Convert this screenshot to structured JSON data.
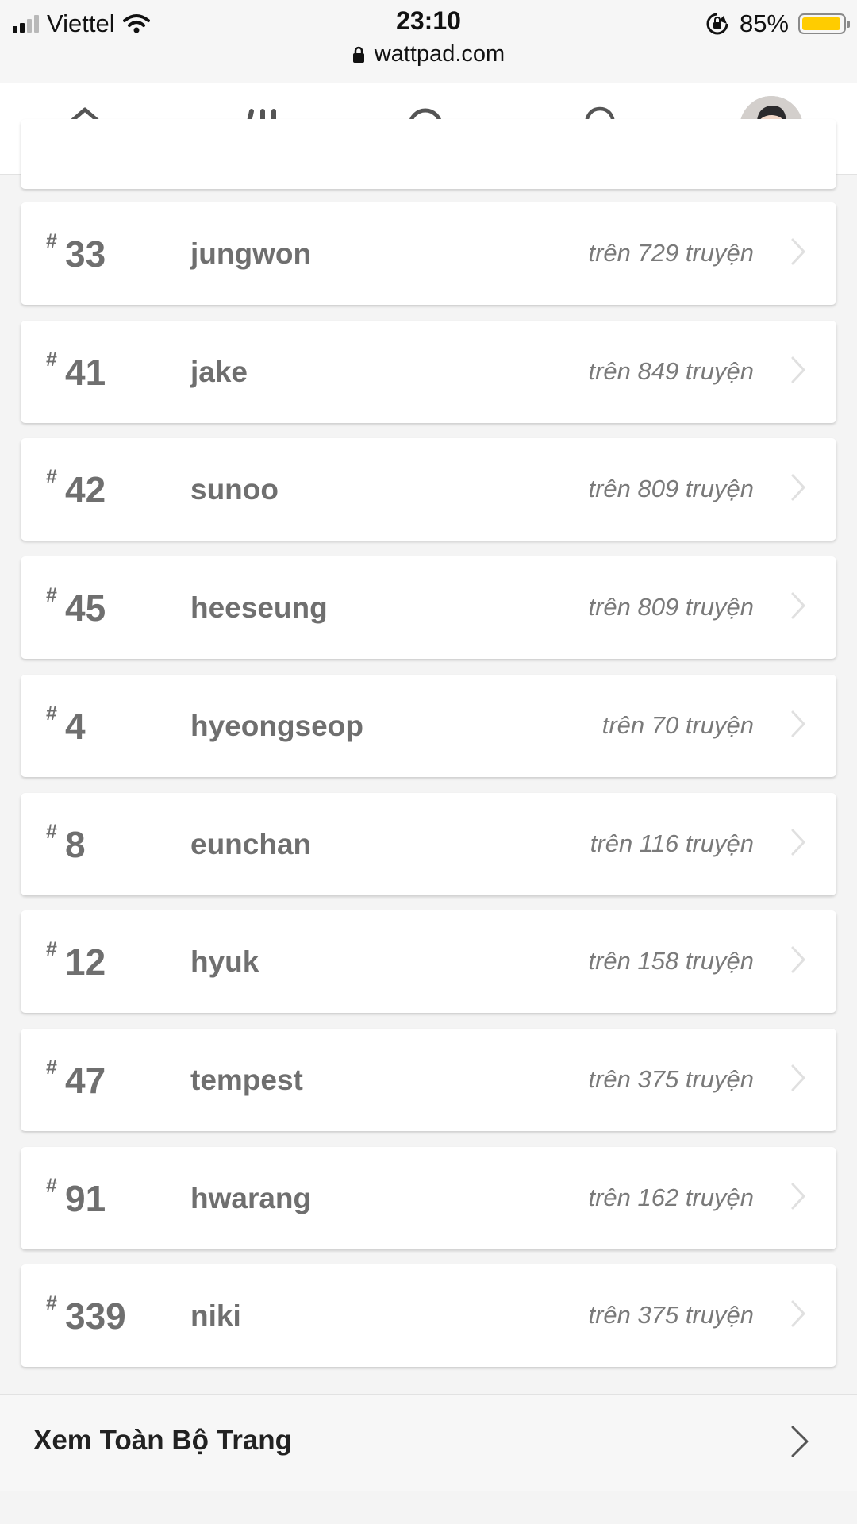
{
  "status_bar": {
    "carrier": "Viettel",
    "time": "23:10",
    "battery_percent": "85%",
    "battery_level": 0.85,
    "url": "wattpad.com"
  },
  "nav": {
    "icons": [
      "home-icon",
      "library-icon",
      "search-icon",
      "bell-icon",
      "avatar"
    ]
  },
  "tags": [
    {
      "hash": "#",
      "rank": "33",
      "name": "jungwon",
      "count": "trên 729 truyện"
    },
    {
      "hash": "#",
      "rank": "41",
      "name": "jake",
      "count": "trên 849 truyện"
    },
    {
      "hash": "#",
      "rank": "42",
      "name": "sunoo",
      "count": "trên 809 truyện"
    },
    {
      "hash": "#",
      "rank": "45",
      "name": "heeseung",
      "count": "trên 809 truyện"
    },
    {
      "hash": "#",
      "rank": "4",
      "name": "hyeongseop",
      "count": "trên 70 truyện"
    },
    {
      "hash": "#",
      "rank": "8",
      "name": "eunchan",
      "count": "trên 116 truyện"
    },
    {
      "hash": "#",
      "rank": "12",
      "name": "hyuk",
      "count": "trên 158 truyện"
    },
    {
      "hash": "#",
      "rank": "47",
      "name": "tempest",
      "count": "trên 375 truyện"
    },
    {
      "hash": "#",
      "rank": "91",
      "name": "hwarang",
      "count": "trên 162 truyện"
    },
    {
      "hash": "#",
      "rank": "339",
      "name": "niki",
      "count": "trên 375 truyện"
    }
  ],
  "see_all": {
    "label": "Xem Toàn Bộ Trang"
  },
  "colors": {
    "battery": "#ffcc00",
    "text_muted": "#6f6f6f",
    "background": "#f4f4f4"
  }
}
